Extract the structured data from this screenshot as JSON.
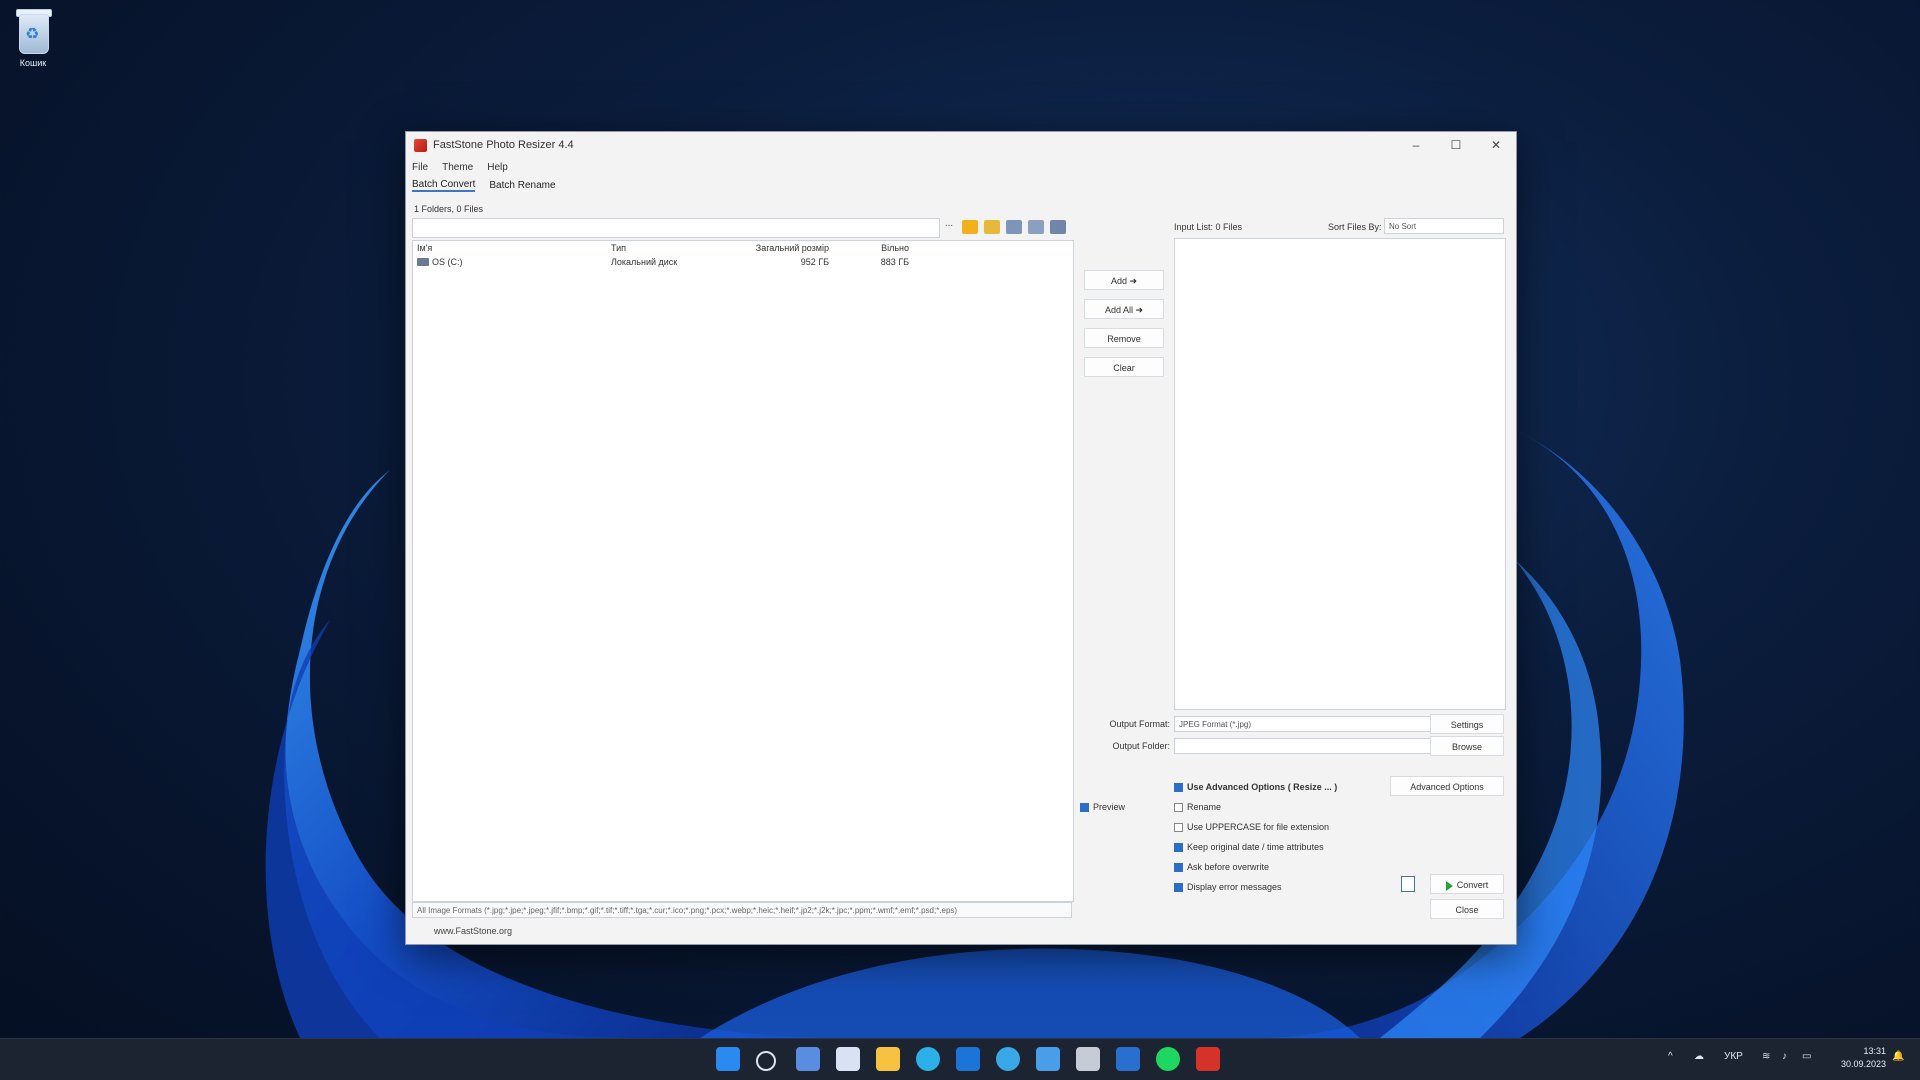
{
  "desktop": {
    "recycle_bin_label": "Кошик"
  },
  "window": {
    "title": "FastStone Photo Resizer 4.4",
    "menu": [
      "File",
      "Theme",
      "Help"
    ],
    "tabs": [
      "Batch Convert",
      "Batch Rename"
    ],
    "folder_info": "1 Folders, 0 Files",
    "path_button": "...",
    "columns": {
      "name": "Ім'я",
      "type": "Тип",
      "total": "Загальний розмір",
      "free": "Вільно"
    },
    "rows": [
      {
        "name": "OS (C:)",
        "type": "Локальний диск",
        "total": "952 ГБ",
        "free": "883 ГБ"
      }
    ],
    "filter": "All Image Formats (*.jpg;*.jpe;*.jpeg;*.jfif;*.bmp;*.gif;*.tif;*.tiff;*.tga;*.cur;*.ico;*.png;*.pcx;*.webp;*.heic;*.heif;*.jp2;*.j2k;*.jpc;*.ppm;*.wmf;*.emf;*.psd;*.eps)",
    "website": "www.FastStone.org",
    "buttons": {
      "add": "Add ➜",
      "add_all": "Add All ➜",
      "remove": "Remove",
      "clear": "Clear"
    },
    "input_list_label": "Input List: 0 Files",
    "sort_label": "Sort Files By:",
    "sort_value": "No Sort",
    "output_format_label": "Output Format:",
    "output_format_value": "JPEG Format (*.jpg)",
    "output_folder_label": "Output Folder:",
    "settings_button": "Settings",
    "browse_button": "Browse",
    "preview_label": "Preview",
    "advanced_options_button": "Advanced Options",
    "options": {
      "use_advanced": "Use Advanced Options ( Resize ... )",
      "rename": "Rename",
      "uppercase": "Use UPPERCASE for file extension",
      "keep_date": "Keep original date / time attributes",
      "ask_overwrite": "Ask before overwrite",
      "display_errors": "Display error messages"
    },
    "convert_button": "Convert",
    "close_button": "Close"
  },
  "taskbar": {
    "tray_lang": "УКР",
    "time": "13:31",
    "date": "30.09.2023"
  }
}
